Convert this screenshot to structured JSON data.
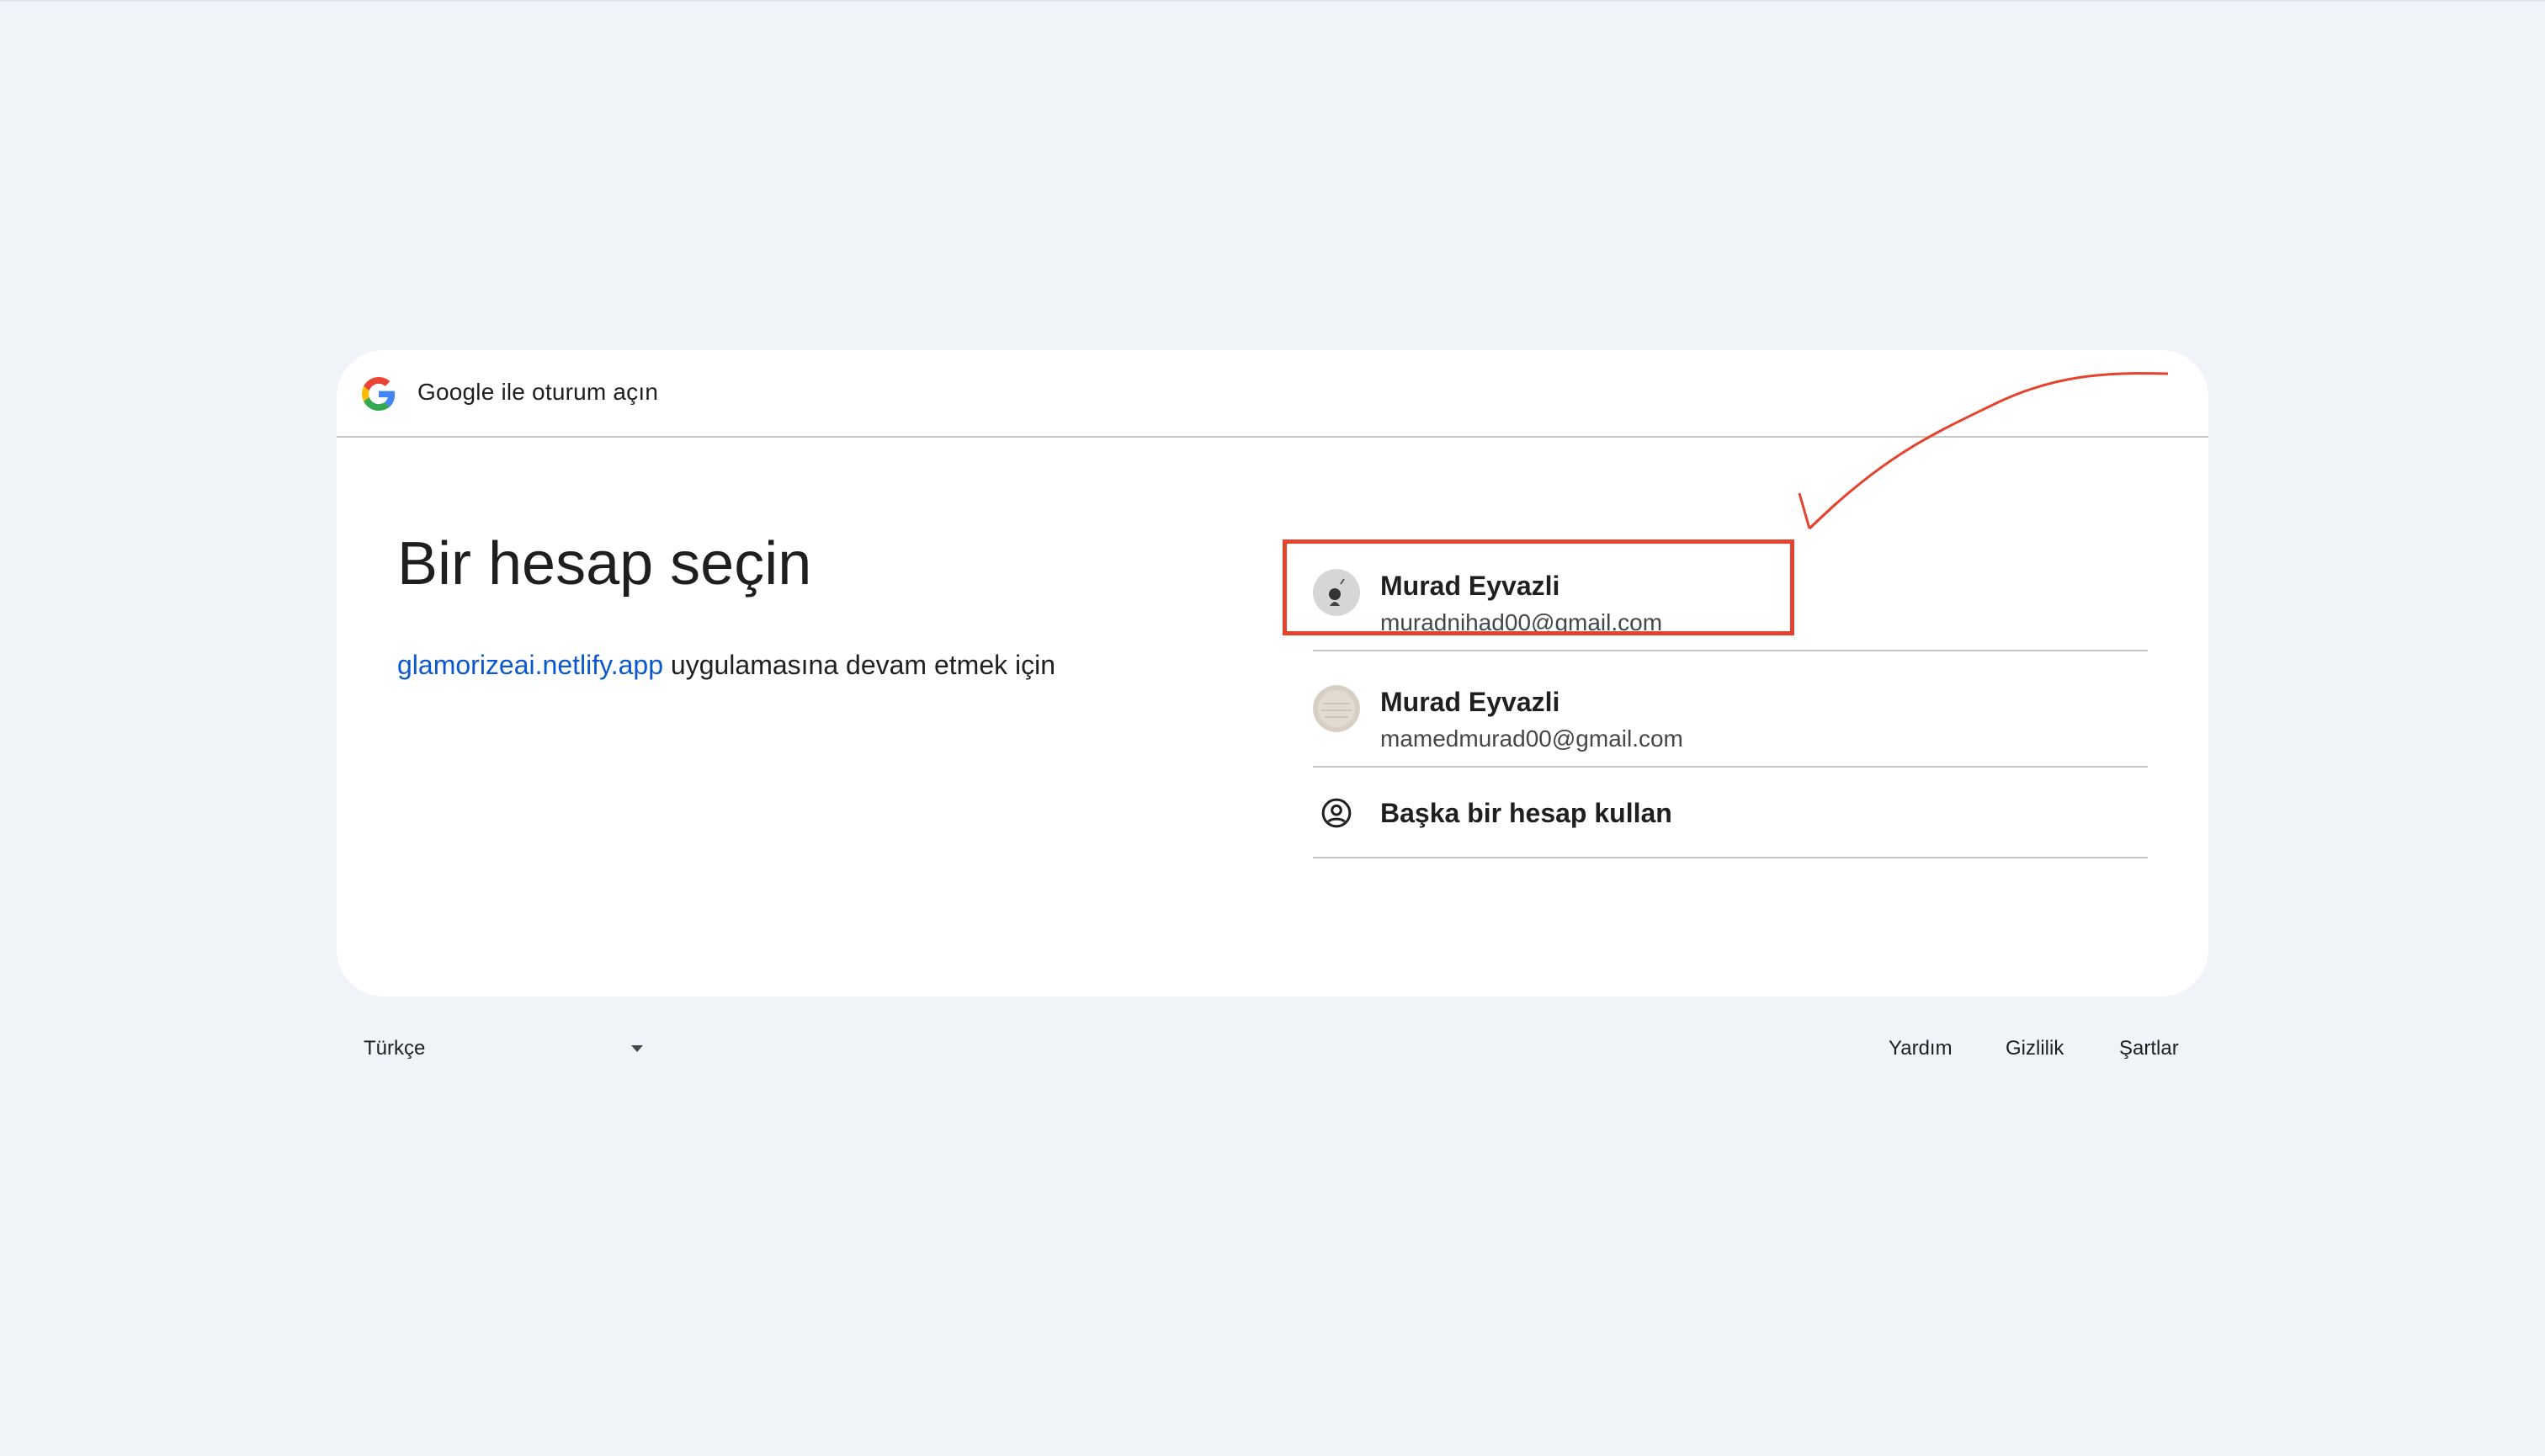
{
  "header": {
    "title": "Google ile oturum açın",
    "logo_icon": "google-g-icon"
  },
  "main": {
    "heading": "Bir hesap seçin",
    "app_link": "glamorizeai.netlify.app",
    "continue_text": "uygulamasına devam etmek için"
  },
  "accounts": [
    {
      "name": "Murad Eyvazli",
      "email": "muradnihad00@gmail.com"
    },
    {
      "name": "Murad Eyvazli",
      "email": "mamedmurad00@gmail.com"
    }
  ],
  "other_account": {
    "label": "Başka bir hesap kullan",
    "icon": "account-circle-icon"
  },
  "footer": {
    "language": "Türkçe",
    "help": "Yardım",
    "privacy": "Gizlilik",
    "terms": "Şartlar"
  },
  "annotation": {
    "color": "#e4432d"
  },
  "colors": {
    "link_blue": "#0b57d0",
    "background": "#f0f4f9"
  }
}
